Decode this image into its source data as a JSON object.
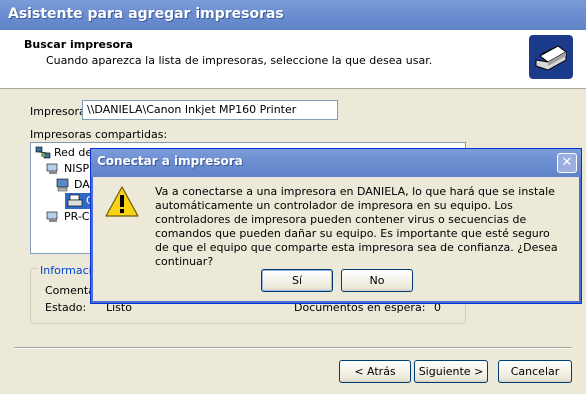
{
  "window": {
    "title": "Asistente para agregar impresoras"
  },
  "header": {
    "title": "Buscar impresora",
    "subtitle": "Cuando aparezca la lista de impresoras, seleccione la que desea usar."
  },
  "printer_field": {
    "label": "Impresora:",
    "value": "\\\\DANIELA\\Canon Inkjet MP160 Printer"
  },
  "shared": {
    "label": "Impresoras compartidas:",
    "items": [
      "Red de",
      "NISP",
      "DA",
      "C",
      "PR-C"
    ]
  },
  "info": {
    "legend": "Informació",
    "comment_label": "Comentar",
    "state_label": "Estado:",
    "state_value": "Listo",
    "docs_label": "Documentos en espera:",
    "docs_value": "0"
  },
  "buttons": {
    "back": "< Atrás",
    "next": "Siguiente >",
    "cancel": "Cancelar"
  },
  "dialog": {
    "title": "Conectar a impresora",
    "message": "Va a conectarse a una impresora en DANIELA, lo que hará que se instale automáticamente un controlador de impresora en su equipo.  Los controladores de impresora pueden contener virus o secuencias de comandos que pueden dañar su equipo.  Es importante que esté seguro de que el equipo que comparte esta impresora sea de confianza.  ¿Desea continuar?",
    "yes": "Sí",
    "no": "No"
  },
  "colors": {
    "titlebar": "#6e90d2",
    "selection": "#316ac5",
    "link_blue": "#0046d5"
  }
}
